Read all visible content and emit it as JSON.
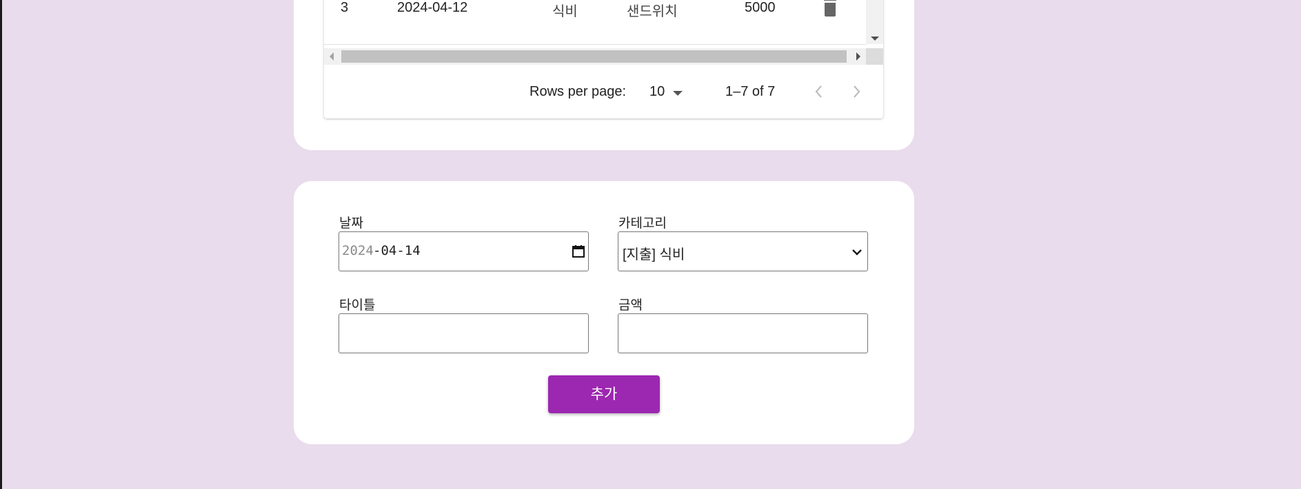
{
  "table": {
    "row": {
      "id": "3",
      "date": "2024-04-12",
      "category": "식비",
      "title": "샌드위치",
      "amount": "5000"
    }
  },
  "pagination": {
    "rows_per_page_label": "Rows per page:",
    "rows_per_page_value": "10",
    "range": "1–7 of 7"
  },
  "form": {
    "date_label": "날짜",
    "date_year": "2024",
    "date_rest": "-04-14",
    "category_label": "카테고리",
    "category_value": "[지출] 식비",
    "title_label": "타이틀",
    "title_value": "",
    "amount_label": "금액",
    "amount_value": "",
    "submit_label": "추가"
  },
  "colors": {
    "background": "#e9dcec",
    "accent": "#9c27b0",
    "card": "#ffffff"
  },
  "icons": [
    "delete-icon",
    "calendar-icon",
    "chevron-down-icon",
    "chevron-left-icon",
    "chevron-right-icon"
  ]
}
